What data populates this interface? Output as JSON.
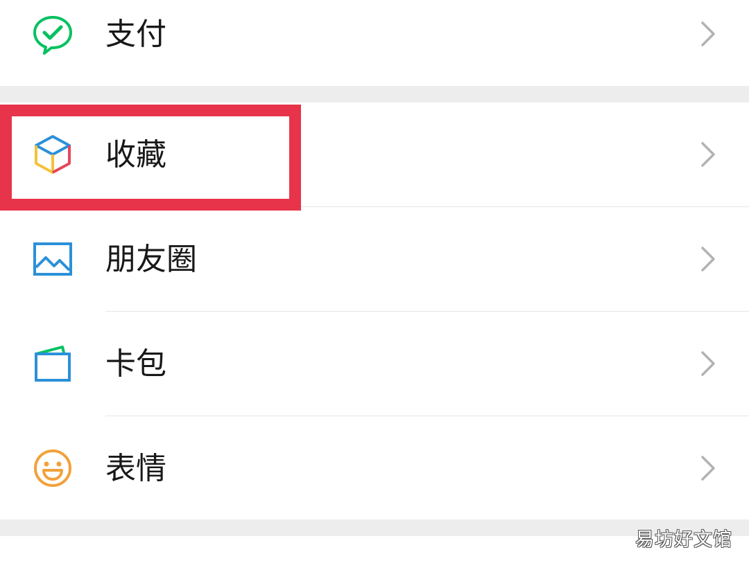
{
  "menu": {
    "items": [
      {
        "id": "pay",
        "label": "支付",
        "icon": "wechat-pay-icon",
        "color": "#07c160"
      },
      {
        "id": "favorites",
        "label": "收藏",
        "icon": "favorites-cube-icon",
        "highlighted": true,
        "highlight_color": "#e7344a"
      },
      {
        "id": "moments",
        "label": "朋友圈",
        "icon": "moments-picture-icon",
        "color": "#2b90d9"
      },
      {
        "id": "card-wallet",
        "label": "卡包",
        "icon": "card-wallet-icon",
        "color": "#2b90d9"
      },
      {
        "id": "stickers",
        "label": "表情",
        "icon": "sticker-smile-icon",
        "color": "#f2a13a"
      }
    ],
    "chevron_icon": "chevron-right-icon"
  },
  "watermark": {
    "text": "易坊好文馆"
  }
}
